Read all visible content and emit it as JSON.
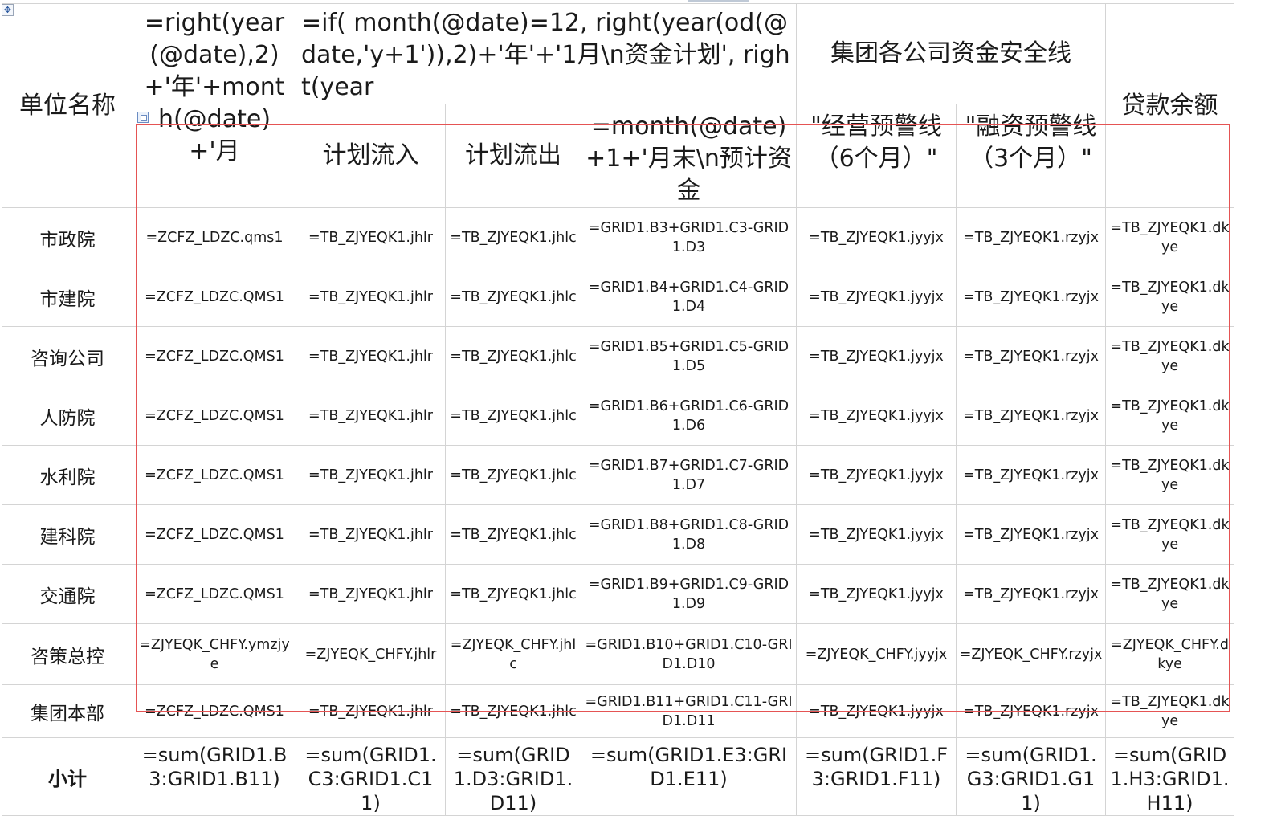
{
  "table": {
    "header": {
      "unit_name": "单位名称",
      "year_formula": "=right(year(@date),2)+'年'+month(@date)+'月",
      "plan_formula": "=if( month(@date)=12, right(year(od(@date,'y+1')),2)+'年'+'1月\\n资金计划', right(year",
      "plan_inflow": "计划流入",
      "plan_outflow": "计划流出",
      "month_end_formula": "=month(@date)+1+'月末\\n预计资金",
      "safety_line": "集团各公司资金安全线",
      "op_warning": "\"经营预警线（6个月）\"",
      "fin_warning": "\"融资预警线（3个月）\"",
      "loan_balance": "贷款余额"
    },
    "rows": [
      {
        "name": "市政院",
        "c1": "=ZCFZ_LDZC.qms1",
        "c2": "=TB_ZJYEQK1.jhlr",
        "c3": "=TB_ZJYEQK1.jhlc",
        "c4": "=GRID1.B3+GRID1.C3-GRID1.D3",
        "c5": "=TB_ZJYEQK1.jyyjx",
        "c6": "=TB_ZJYEQK1.rzyjx",
        "c7": "=TB_ZJYEQK1.dkye"
      },
      {
        "name": "市建院",
        "c1": "=ZCFZ_LDZC.QMS1",
        "c2": "=TB_ZJYEQK1.jhlr",
        "c3": "=TB_ZJYEQK1.jhlc",
        "c4": "=GRID1.B4+GRID1.C4-GRID1.D4",
        "c5": "=TB_ZJYEQK1.jyyjx",
        "c6": "=TB_ZJYEQK1.rzyjx",
        "c7": "=TB_ZJYEQK1.dkye"
      },
      {
        "name": "咨询公司",
        "c1": "=ZCFZ_LDZC.QMS1",
        "c2": "=TB_ZJYEQK1.jhlr",
        "c3": "=TB_ZJYEQK1.jhlc",
        "c4": "=GRID1.B5+GRID1.C5-GRID1.D5",
        "c5": "=TB_ZJYEQK1.jyyjx",
        "c6": "=TB_ZJYEQK1.rzyjx",
        "c7": "=TB_ZJYEQK1.dkye"
      },
      {
        "name": "人防院",
        "c1": "=ZCFZ_LDZC.QMS1",
        "c2": "=TB_ZJYEQK1.jhlr",
        "c3": "=TB_ZJYEQK1.jhlc",
        "c4": "=GRID1.B6+GRID1.C6-GRID1.D6",
        "c5": "=TB_ZJYEQK1.jyyjx",
        "c6": "=TB_ZJYEQK1.rzyjx",
        "c7": "=TB_ZJYEQK1.dkye"
      },
      {
        "name": "水利院",
        "c1": "=ZCFZ_LDZC.QMS1",
        "c2": "=TB_ZJYEQK1.jhlr",
        "c3": "=TB_ZJYEQK1.jhlc",
        "c4": "=GRID1.B7+GRID1.C7-GRID1.D7",
        "c5": "=TB_ZJYEQK1.jyyjx",
        "c6": "=TB_ZJYEQK1.rzyjx",
        "c7": "=TB_ZJYEQK1.dkye"
      },
      {
        "name": "建科院",
        "c1": "=ZCFZ_LDZC.QMS1",
        "c2": "=TB_ZJYEQK1.jhlr",
        "c3": "=TB_ZJYEQK1.jhlc",
        "c4": "=GRID1.B8+GRID1.C8-GRID1.D8",
        "c5": "=TB_ZJYEQK1.jyyjx",
        "c6": "=TB_ZJYEQK1.rzyjx",
        "c7": "=TB_ZJYEQK1.dkye"
      },
      {
        "name": "交通院",
        "c1": "=ZCFZ_LDZC.QMS1",
        "c2": "=TB_ZJYEQK1.jhlr",
        "c3": "=TB_ZJYEQK1.jhlc",
        "c4": "=GRID1.B9+GRID1.C9-GRID1.D9",
        "c5": "=TB_ZJYEQK1.jyyjx",
        "c6": "=TB_ZJYEQK1.rzyjx",
        "c7": "=TB_ZJYEQK1.dkye"
      },
      {
        "name": "咨策总控",
        "c1": "=ZJYEQK_CHFY.ymzjye",
        "c2": "=ZJYEQK_CHFY.jhlr",
        "c3": "=ZJYEQK_CHFY.jhlc",
        "c4": "=GRID1.B10+GRID1.C10-GRID1.D10",
        "c5": "=ZJYEQK_CHFY.jyyjx",
        "c6": "=ZJYEQK_CHFY.rzyjx",
        "c7": "=ZJYEQK_CHFY.dkye"
      },
      {
        "name": "集团本部",
        "c1": "=ZCFZ_LDZC.QMS1",
        "c2": "=TB_ZJYEQK1.jhlr",
        "c3": "=TB_ZJYEQK1.jhlc",
        "c4": "=GRID1.B11+GRID1.C11-GRID1.D11",
        "c5": "=TB_ZJYEQK1.jyyjx",
        "c6": "=TB_ZJYEQK1.rzyjx",
        "c7": "=TB_ZJYEQK1.dkye"
      }
    ],
    "total": {
      "label": "小计",
      "c1": "=sum(GRID1.B3:GRID1.B11)",
      "c2": "=sum(GRID1.C3:GRID1.C11)",
      "c3": "=sum(GRID1.D3:GRID1.D11)",
      "c4": "=sum(GRID1.E3:GRID1.E11)",
      "c5": "=sum(GRID1.F3:GRID1.F11)",
      "c6": "=sum(GRID1.G3:GRID1.G11)",
      "c7": "=sum(GRID1.H3:GRID1.H11)"
    }
  },
  "icons": {
    "table_move_handle": "move-icon",
    "selection_handle": "select-range-icon"
  },
  "colors": {
    "selection_border": "#e55454",
    "grid_line": "#d4d4d4"
  }
}
